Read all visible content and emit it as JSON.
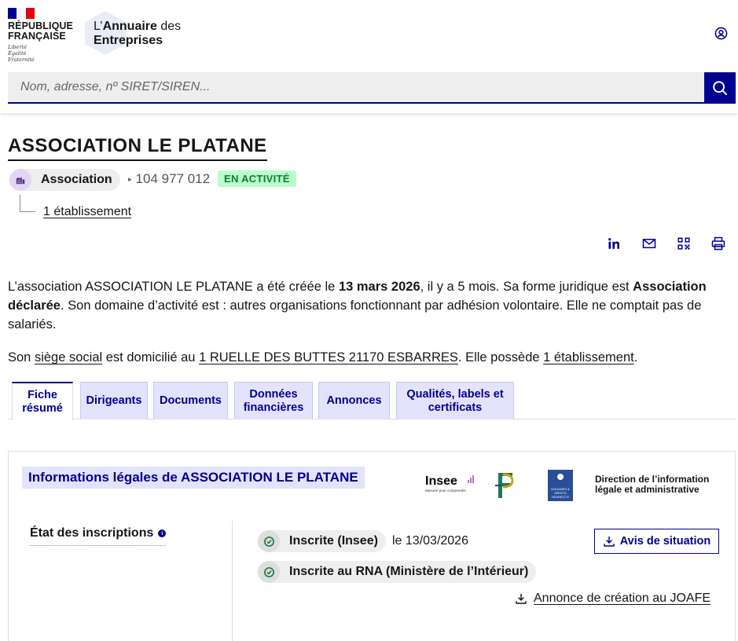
{
  "header": {
    "republic": [
      "RÉPUBLIQUE",
      "FRANÇAISE"
    ],
    "motto": [
      "Liberté",
      "Égalité",
      "Fraternité"
    ],
    "site_name_prefix": "L’",
    "site_name_bold": "Annuaire",
    "site_name_suffix": " des",
    "site_name_line2": "Entreprises",
    "user_icon": "user-circle-icon"
  },
  "search": {
    "placeholder": "Nom, adresse, nº SIRET/SIREN...",
    "button_icon": "search-icon"
  },
  "company": {
    "name": "ASSOCIATION LE PLATANE",
    "type_label": "Association",
    "siren": "104 977 012",
    "status": "EN ACTIVITÉ",
    "etablissements_link": "1 établissement"
  },
  "share_icons": [
    "linkedin-icon",
    "mail-icon",
    "qrcode-icon",
    "print-icon"
  ],
  "description": {
    "p1_a": "L’association ASSOCIATION LE PLATANE a été créée le ",
    "p1_date": "13 mars 2026",
    "p1_b": ", il y a 5 mois. Sa forme juridique est ",
    "p1_form": "Association déclarée",
    "p1_c": ". Son domaine d’activité est : autres organisations fonctionnant par adhésion volontaire. Elle ne comptait pas de salariés.",
    "p2_a": "Son ",
    "p2_siege": "siège social",
    "p2_b": " est domicilié au ",
    "p2_address": "1 RUELLE DES BUTTES 21170 ESBARRES",
    "p2_c": ". Elle possède ",
    "p2_etab": "1 établissement",
    "p2_d": "."
  },
  "tabs": [
    {
      "label_1": "Fiche",
      "label_2": "résumé",
      "active": true
    },
    {
      "label_1": "Dirigeants"
    },
    {
      "label_1": "Documents"
    },
    {
      "label_1": "Données",
      "label_2": "financières"
    },
    {
      "label_1": "Annonces"
    },
    {
      "label_1": "Qualités, labels et",
      "label_2": "certificats"
    }
  ],
  "panel": {
    "title": "Informations légales de ASSOCIATION LE PLATANE",
    "insee_logo": "Insee",
    "insee_tagline": "Mesurer pour comprendre",
    "douanes_text": "DOUANES & DROITS INDIRECTS",
    "dila_line1": "Direction de l’information",
    "dila_line2": "légale et administrative",
    "etat_label": "État des inscriptions",
    "inscription_1": "Inscrite (Insee)",
    "inscription_1_date": "le 13/03/2026",
    "inscription_2": "Inscrite au RNA (Ministère de l’Intérieur)",
    "avis_button": "Avis de situation",
    "joafe_link": "Annonce de création au JOAFE"
  },
  "colors": {
    "primary": "#000091",
    "status_bg": "#b8fec9",
    "status_text": "#18753c",
    "tab_bg": "#e3e3fd"
  }
}
